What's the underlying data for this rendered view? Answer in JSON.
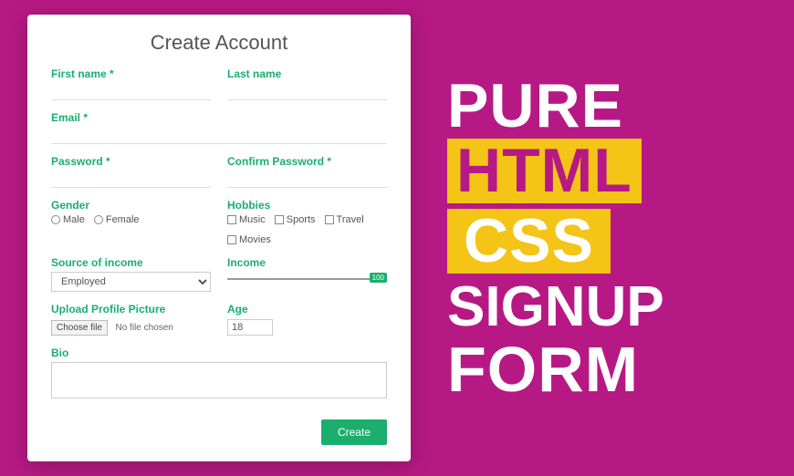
{
  "form": {
    "title": "Create Account",
    "first_name": {
      "label": "First name *",
      "placeholder": ""
    },
    "last_name": {
      "label": "Last name",
      "placeholder": ""
    },
    "email": {
      "label": "Email *",
      "placeholder": ""
    },
    "password": {
      "label": "Password *",
      "placeholder": ""
    },
    "confirm": {
      "label": "Confirm Password *",
      "placeholder": ""
    },
    "gender": {
      "label": "Gender",
      "options": [
        "Male",
        "Female"
      ]
    },
    "hobbies": {
      "label": "Hobbies",
      "options": [
        "Music",
        "Sports",
        "Travel",
        "Movies"
      ]
    },
    "income_source": {
      "label": "Source of income",
      "value": "Employed"
    },
    "income": {
      "label": "Income",
      "badge": "100"
    },
    "upload": {
      "label": "Upload Profile Picture",
      "button": "Choose file",
      "status": "No file chosen"
    },
    "age": {
      "label": "Age",
      "value": "18"
    },
    "bio": {
      "label": "Bio"
    },
    "submit": "Create"
  },
  "headline": {
    "l1": "PURE",
    "l2": "HTML",
    "l3": "CSS",
    "l4": "SIGNUP",
    "l5": "FORM"
  }
}
